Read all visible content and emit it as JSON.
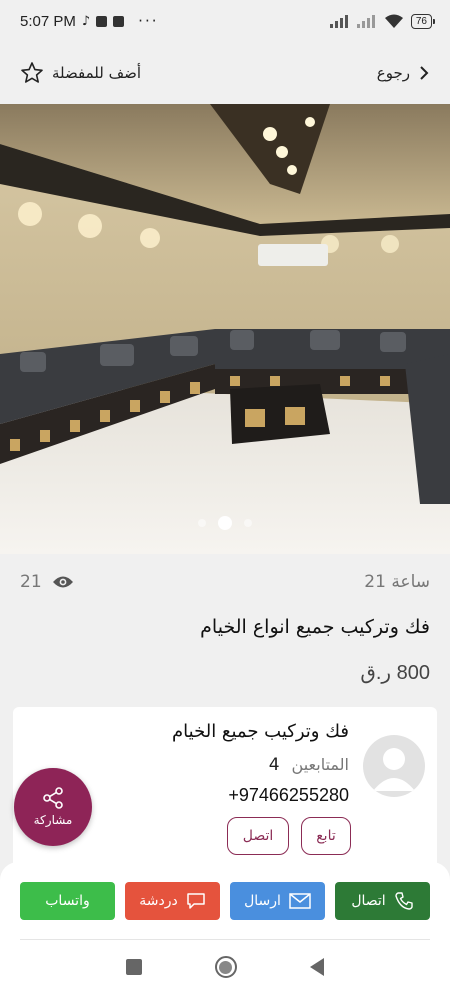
{
  "status_bar": {
    "time": "5:07 PM",
    "battery": "76",
    "more": "···"
  },
  "header": {
    "favorite_label": "أضف للمفضلة",
    "back_label": "رجوع"
  },
  "gallery": {
    "image_count": 3,
    "active_index": 1
  },
  "listing": {
    "time_ago": "21 ساعة",
    "views": "21",
    "title": "فك وتركيب جميع انواع الخيام",
    "price": "800 ر.ق"
  },
  "seller": {
    "name": "فك وتركيب جميع الخيام",
    "followers_label": "المتابعين",
    "followers_count": "4",
    "phone": "+97466255280",
    "follow_label": "تابع",
    "contact_label": "اتصل"
  },
  "share": {
    "label": "مشاركة"
  },
  "actions": {
    "call": "اتصال",
    "send": "ارسال",
    "chat": "دردشة",
    "whatsapp": "واتساب"
  },
  "colors": {
    "accent": "#8e2457",
    "whatsapp": "#3dbd4a",
    "chat": "#e5533d",
    "send": "#4a8fde",
    "call": "#2d7a36"
  }
}
